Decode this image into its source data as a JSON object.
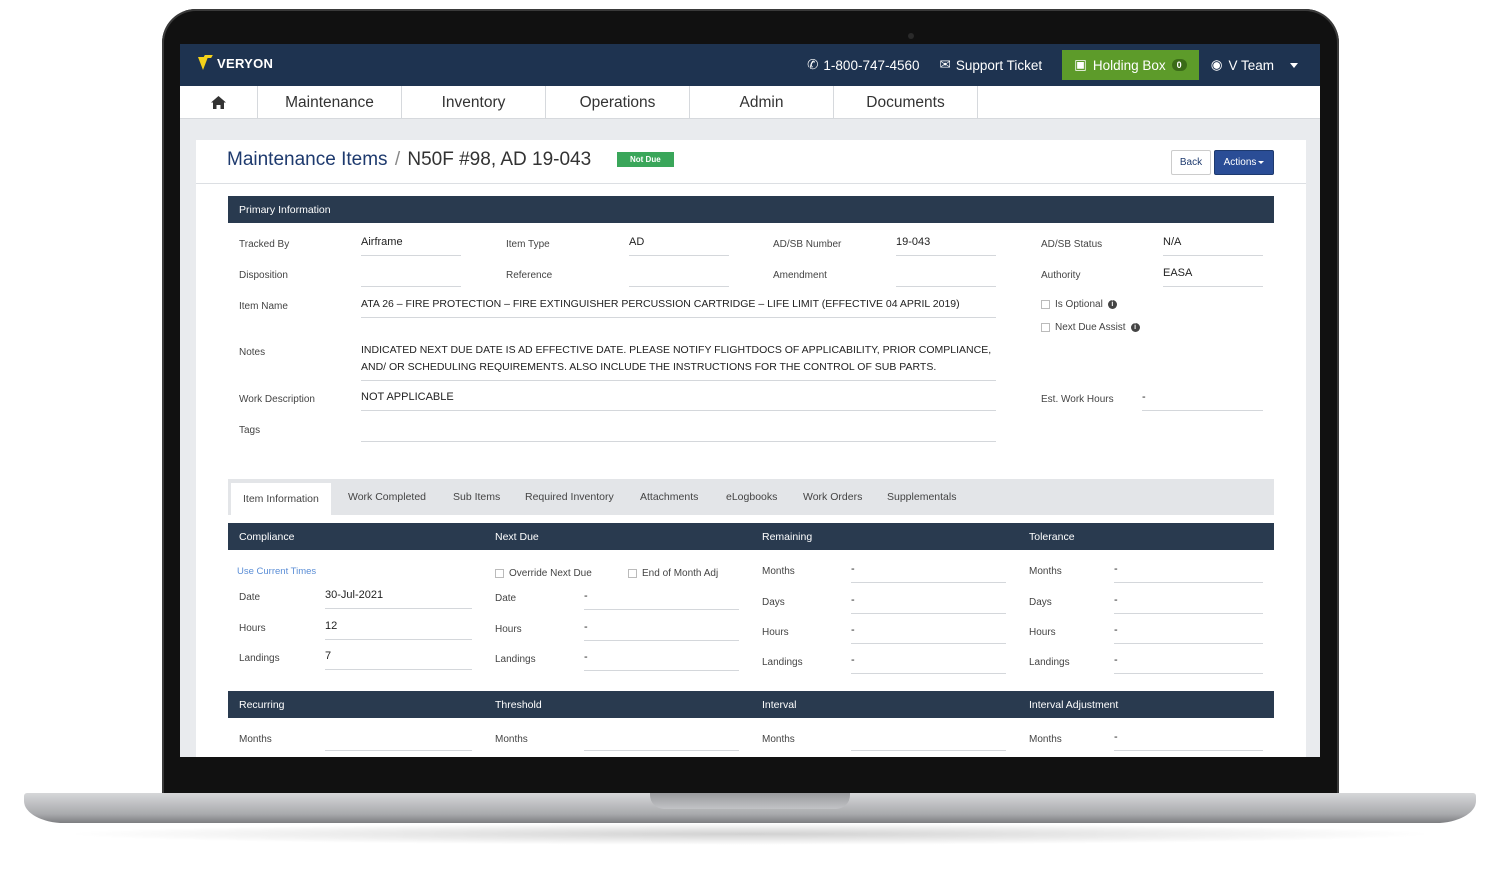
{
  "header": {
    "logo_text": "VERYON",
    "phone": "1-800-747-4560",
    "support": "Support Ticket",
    "holding_box": "Holding Box",
    "holding_box_count": "0",
    "user": "V Team"
  },
  "nav": {
    "items": [
      "Maintenance",
      "Inventory",
      "Operations",
      "Admin",
      "Documents"
    ]
  },
  "page": {
    "breadcrumb_root": "Maintenance Items",
    "breadcrumb_sep": "/",
    "breadcrumb_current": "N50F #98, AD 19-043",
    "status": "Not Due",
    "back": "Back",
    "actions": "Actions"
  },
  "primary": {
    "header": "Primary Information",
    "tracked_by_label": "Tracked By",
    "tracked_by": "Airframe",
    "item_type_label": "Item Type",
    "item_type": "AD",
    "adsb_number_label": "AD/SB Number",
    "adsb_number": "19-043",
    "adsb_status_label": "AD/SB Status",
    "adsb_status": "N/A",
    "disposition_label": "Disposition",
    "disposition": "",
    "reference_label": "Reference",
    "reference": "",
    "amendment_label": "Amendment",
    "amendment": "",
    "authority_label": "Authority",
    "authority": "EASA",
    "item_name_label": "Item Name",
    "item_name": "ATA 26 – FIRE PROTECTION – FIRE EXTINGUISHER PERCUSSION CARTRIDGE – LIFE LIMIT (EFFECTIVE 04 APRIL 2019)",
    "is_optional": "Is Optional",
    "next_due_assist": "Next Due Assist",
    "notes_label": "Notes",
    "notes": "INDICATED NEXT DUE DATE IS AD EFFECTIVE DATE. PLEASE NOTIFY FLIGHTDOCS OF APPLICABILITY, PRIOR COMPLIANCE, AND/ OR SCHEDULING REQUIREMENTS. ALSO INCLUDE THE INSTRUCTIONS FOR THE CONTROL OF SUB PARTS.",
    "work_description_label": "Work Description",
    "work_description": "NOT APPLICABLE",
    "est_work_hours_label": "Est. Work Hours",
    "est_work_hours": "-",
    "tags_label": "Tags",
    "tags": ""
  },
  "tabs": [
    "Item Information",
    "Work Completed",
    "Sub Items",
    "Required Inventory",
    "Attachments",
    "eLogbooks",
    "Work Orders",
    "Supplementals"
  ],
  "compliance": {
    "headers": [
      "Compliance",
      "Next Due",
      "Remaining",
      "Tolerance"
    ],
    "use_current_times": "Use Current Times",
    "override_next_due": "Override Next Due",
    "end_of_month_adj": "End of Month Adj",
    "date_label": "Date",
    "date": "30-Jul-2021",
    "hours_label": "Hours",
    "hours": "12",
    "landings_label": "Landings",
    "landings": "7",
    "months_label": "Months",
    "days_label": "Days",
    "dash": "-"
  },
  "recurring": {
    "headers": [
      "Recurring",
      "Threshold",
      "Interval",
      "Interval Adjustment"
    ],
    "months_label": "Months",
    "dash": "-"
  }
}
